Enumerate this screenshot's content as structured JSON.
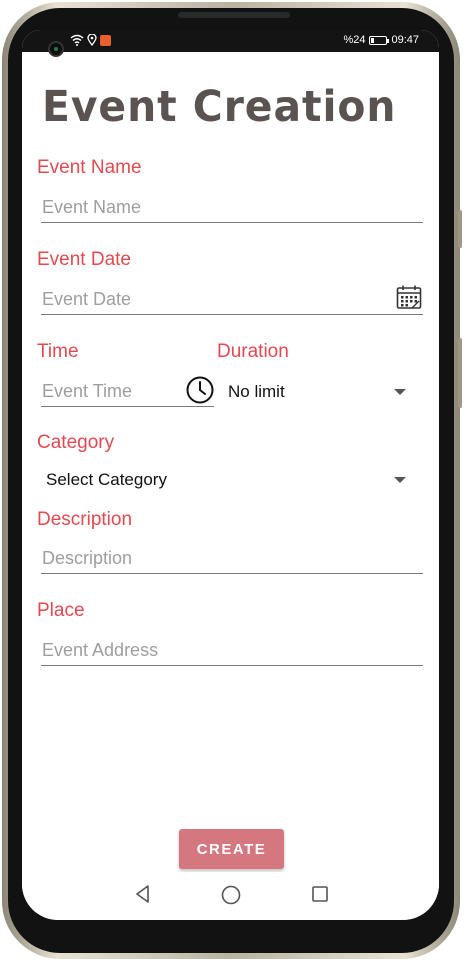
{
  "status_bar": {
    "battery_percent": "%24",
    "battery_level": 0.24,
    "time": "09:47",
    "icons": [
      "wifi-icon",
      "location-icon",
      "app-notification-icon"
    ]
  },
  "form": {
    "title": "Event Creation",
    "event_name": {
      "label": "Event Name",
      "placeholder": "Event Name"
    },
    "event_date": {
      "label": "Event Date",
      "placeholder": "Event Date",
      "icon": "calendar-icon"
    },
    "time": {
      "label": "Time",
      "placeholder": "Event Time",
      "icon": "clock-icon"
    },
    "duration": {
      "label": "Duration",
      "value": "No limit"
    },
    "category": {
      "label": "Category",
      "value": "Select Category"
    },
    "description": {
      "label": "Description",
      "placeholder": "Description"
    },
    "place": {
      "label": "Place",
      "placeholder": "Event Address"
    },
    "create_button": "CREATE",
    "accent_color": "#e04a50",
    "button_color": "#d4777f"
  },
  "nav_bar": {
    "icons": [
      "back-icon",
      "home-icon",
      "recents-icon"
    ]
  }
}
